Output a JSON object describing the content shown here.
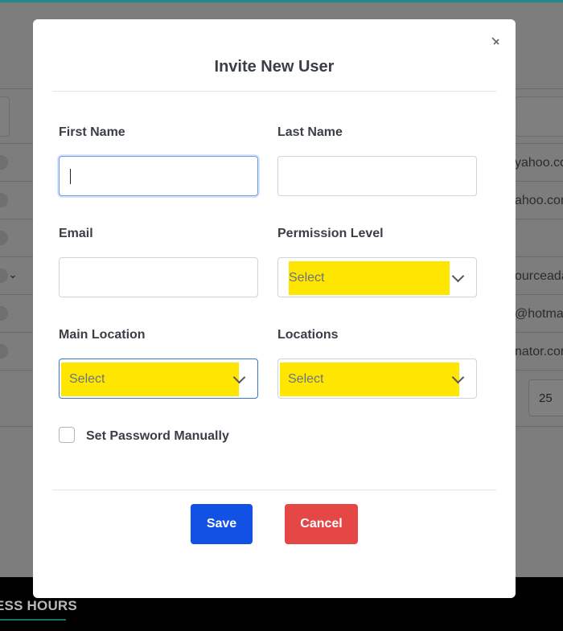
{
  "background": {
    "partial_texts": [
      "yahoo.co",
      "ahoo.con",
      "ourceada",
      "@hotmail",
      "nator.cor"
    ],
    "per_page": "25",
    "footer_title": "ESS HOURS"
  },
  "modal": {
    "title": "Invite New User",
    "close_icon": "close-icon",
    "fields": {
      "first_name": {
        "label": "First Name",
        "value": ""
      },
      "last_name": {
        "label": "Last Name",
        "value": ""
      },
      "email": {
        "label": "Email",
        "value": ""
      },
      "permission_level": {
        "label": "Permission Level",
        "value": "Select"
      },
      "main_location": {
        "label": "Main Location",
        "value": "Select"
      },
      "locations": {
        "label": "Locations",
        "value": "Select"
      }
    },
    "set_password": {
      "label": "Set Password Manually",
      "checked": false
    },
    "buttons": {
      "save": "Save",
      "cancel": "Cancel"
    }
  },
  "colors": {
    "save": "#1151e3",
    "cancel": "#e54646",
    "highlight": "#ffe600",
    "accent": "#1f8a87"
  }
}
